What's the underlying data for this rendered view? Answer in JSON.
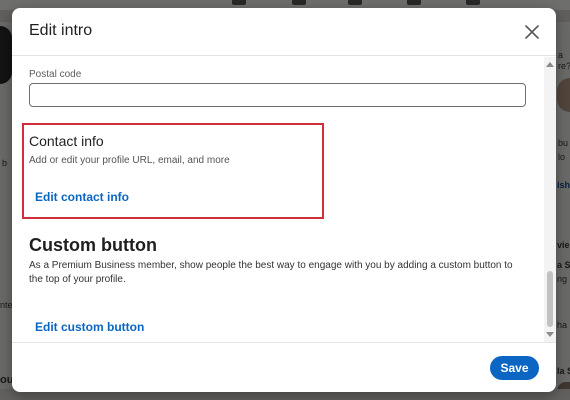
{
  "modal": {
    "title": "Edit intro",
    "close_icon": "close-icon"
  },
  "postal_code": {
    "label": "Postal code",
    "value": "",
    "placeholder": ""
  },
  "contact_info": {
    "title": "Contact info",
    "description": "Add or edit your profile URL, email, and more",
    "link": "Edit contact info",
    "highlight_color": "#d0303b"
  },
  "custom_button": {
    "title": "Custom button",
    "description": "As a Premium Business member, show people the best way to engage with you by adding a custom button to the top of your profile.",
    "link": "Edit custom button"
  },
  "footer": {
    "save_label": "Save"
  },
  "colors": {
    "accent": "#0a66c2",
    "highlight": "#d0303b"
  },
  "background_fragments": {
    "left_1": "b",
    "left_2": "nte",
    "left_3": "ou",
    "right_1": "a",
    "right_2": "re?",
    "right_3": "bu",
    "right_4": "lo",
    "right_5": "ish",
    "right_6": "vie",
    "right_7": "a S",
    "right_8": "ng",
    "right_9": "ha",
    "right_10": "la S"
  }
}
